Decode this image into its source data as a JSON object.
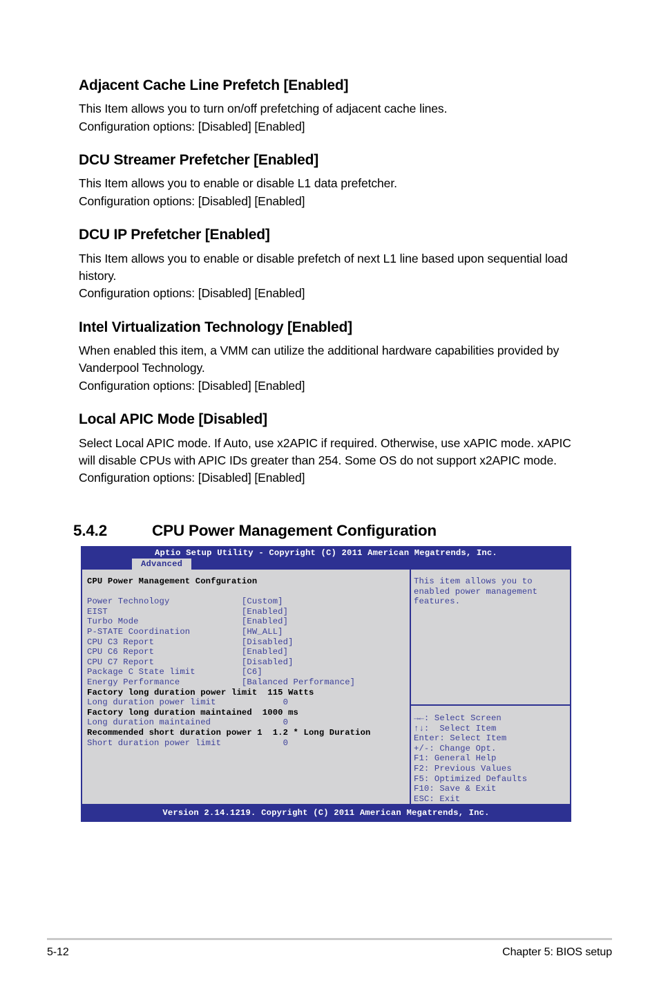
{
  "document": {
    "sections": [
      {
        "heading": "Adjacent Cache Line Prefetch [Enabled]",
        "lines": [
          "This Item allows you to turn on/off prefetching of adjacent cache lines.",
          "Configuration options: [Disabled] [Enabled]"
        ]
      },
      {
        "heading": "DCU Streamer Prefetcher [Enabled]",
        "lines": [
          "This Item allows you to enable or disable L1 data prefetcher.",
          "Configuration options: [Disabled] [Enabled]"
        ]
      },
      {
        "heading": "DCU IP Prefetcher [Enabled]",
        "lines": [
          "This Item allows you to enable or disable prefetch of next L1 line based upon sequential load history.",
          "Configuration options: [Disabled] [Enabled]"
        ]
      },
      {
        "heading": "Intel Virtualization Technology [Enabled]",
        "lines": [
          "When enabled this item, a VMM can utilize the additional hardware capabilities provided by Vanderpool Technology.",
          "Configuration options: [Disabled] [Enabled]"
        ]
      },
      {
        "heading": "Local APIC Mode [Disabled]",
        "lines": [
          "Select Local APIC mode. If Auto, use x2APIC if required. Otherwise, use xAPIC mode. xAPIC will disable CPUs with APIC IDs greater than 254. Some OS do not support x2APIC mode. Configuration options: [Disabled] [Enabled]"
        ]
      }
    ],
    "numbered_section": {
      "number": "5.4.2",
      "title": "CPU Power Management Configuration"
    }
  },
  "bios": {
    "title": "Aptio Setup Utility - Copyright (C) 2011 American Megatrends, Inc.",
    "tab": "Advanced",
    "section_title": "CPU Power Management Confguration",
    "options": [
      {
        "name": "Power Technology",
        "value": "[Custom]",
        "type": "setting"
      },
      {
        "name": "EIST",
        "value": "[Enabled]",
        "type": "setting"
      },
      {
        "name": "Turbo Mode",
        "value": "[Enabled]",
        "type": "setting"
      },
      {
        "name": "P-STATE Coordination",
        "value": "[HW_ALL]",
        "type": "setting"
      },
      {
        "name": "CPU C3 Report",
        "value": "[Disabled]",
        "type": "setting"
      },
      {
        "name": "CPU C6 Report",
        "value": "[Enabled]",
        "type": "setting"
      },
      {
        "name": "CPU C7 Report",
        "value": "[Disabled]",
        "type": "setting"
      },
      {
        "name": "Package C State limit",
        "value": "[C6]",
        "type": "setting"
      },
      {
        "name": "Energy Performance",
        "value": "[Balanced Performance]",
        "type": "setting"
      },
      {
        "name": "Factory long duration power limit",
        "value": "115 Watts",
        "type": "info"
      },
      {
        "name": "Long duration power limit",
        "value": "0",
        "type": "setting"
      },
      {
        "name": "Factory long duration maintained",
        "value": "1000 ms",
        "type": "info"
      },
      {
        "name": "Long duration maintained",
        "value": "0",
        "type": "setting"
      },
      {
        "name": "Recommended short duration power 1",
        "value": "1.2 * Long Duration",
        "type": "info"
      },
      {
        "name": "Short duration power limit",
        "value": "0",
        "type": "setting"
      }
    ],
    "help": "This item allows you to\nenabled power management\nfeatures.",
    "keys": [
      "→←: Select Screen",
      "↑↓:  Select Item",
      "Enter: Select Item",
      "+/-: Change Opt.",
      "F1: General Help",
      "F2: Previous Values",
      "F5: Optimized Defaults",
      "F10: Save & Exit",
      "ESC: Exit"
    ],
    "footer": "Version 2.14.1219. Copyright (C) 2011 American Megatrends, Inc.",
    "colors": {
      "chrome_blue": "#2d3192",
      "panel_gray": "#d4d4d6",
      "option_blue": "#3b3f99",
      "info_black": "#000000"
    }
  },
  "page_footer": {
    "page_number": "5-12",
    "chapter": "Chapter 5: BIOS setup"
  }
}
